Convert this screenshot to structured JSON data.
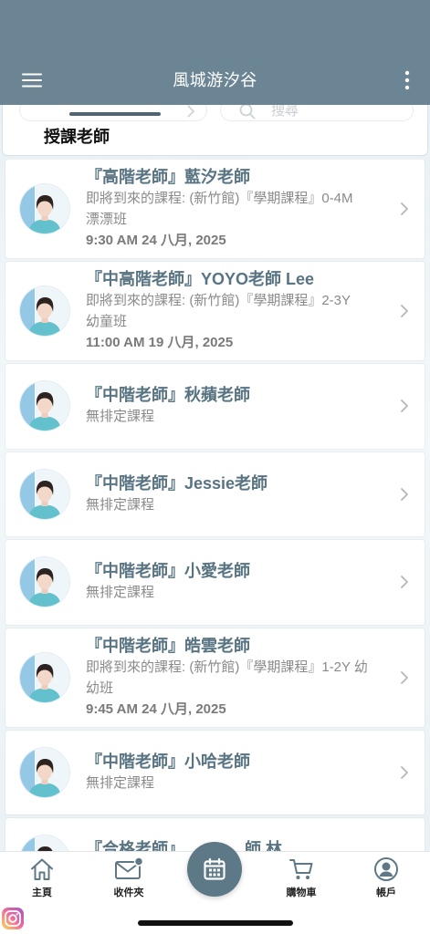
{
  "app": {
    "title": "風城游汐谷"
  },
  "header": {
    "menu_icon": "hamburger-menu-icon",
    "more_icon": "more-vertical-icon"
  },
  "subheader": {
    "search_icon": "search-icon",
    "search_placeholder": "搜尋",
    "section_title": "授課老師"
  },
  "teachers": [
    {
      "name": "『高階老師』藍汐老師",
      "upcoming_line1": "即將到來的課程: (新竹館)『學期課程』0-4M",
      "upcoming_line2": "漂漂班",
      "time": "9:30 AM 24 八月, 2025"
    },
    {
      "name": "『中高階老師』YOYO老師 Lee",
      "upcoming_line1": "即將到來的課程: (新竹館)『學期課程』2-3Y",
      "upcoming_line2": "幼童班",
      "time": "11:00 AM 19 八月, 2025"
    },
    {
      "name": "『中階老師』秋蘋老師",
      "status": "無排定課程"
    },
    {
      "name": "『中階老師』Jessie老師",
      "status": "無排定課程"
    },
    {
      "name": "『中階老師』小愛老師",
      "status": "無排定課程"
    },
    {
      "name": "『中階老師』皓雲老師",
      "upcoming_line1": "即將到來的課程: (新竹館)『學期課程』1-2Y 幼",
      "upcoming_line2": "幼班",
      "time": "9:45 AM 24 八月, 2025"
    },
    {
      "name": "『中階老師』小哈老師",
      "status": "無排定課程"
    },
    {
      "name_part1": "『合格老師』",
      "name_part2": "師 林"
    }
  ],
  "nav": {
    "items": [
      {
        "label": "主頁",
        "icon": "home-icon"
      },
      {
        "label": "收件夾",
        "icon": "inbox-mail-icon"
      },
      {
        "label": "購物車",
        "icon": "cart-icon"
      },
      {
        "label": "帳戶",
        "icon": "account-icon"
      }
    ],
    "center_button": {
      "icon": "calendar-icon"
    }
  },
  "watermark": {
    "icon": "instagram-icon"
  },
  "colors": {
    "header": "#6b8594",
    "accent": "#5d7886",
    "teacher_name": "#587482",
    "muted_text": "#8a8a8a"
  }
}
